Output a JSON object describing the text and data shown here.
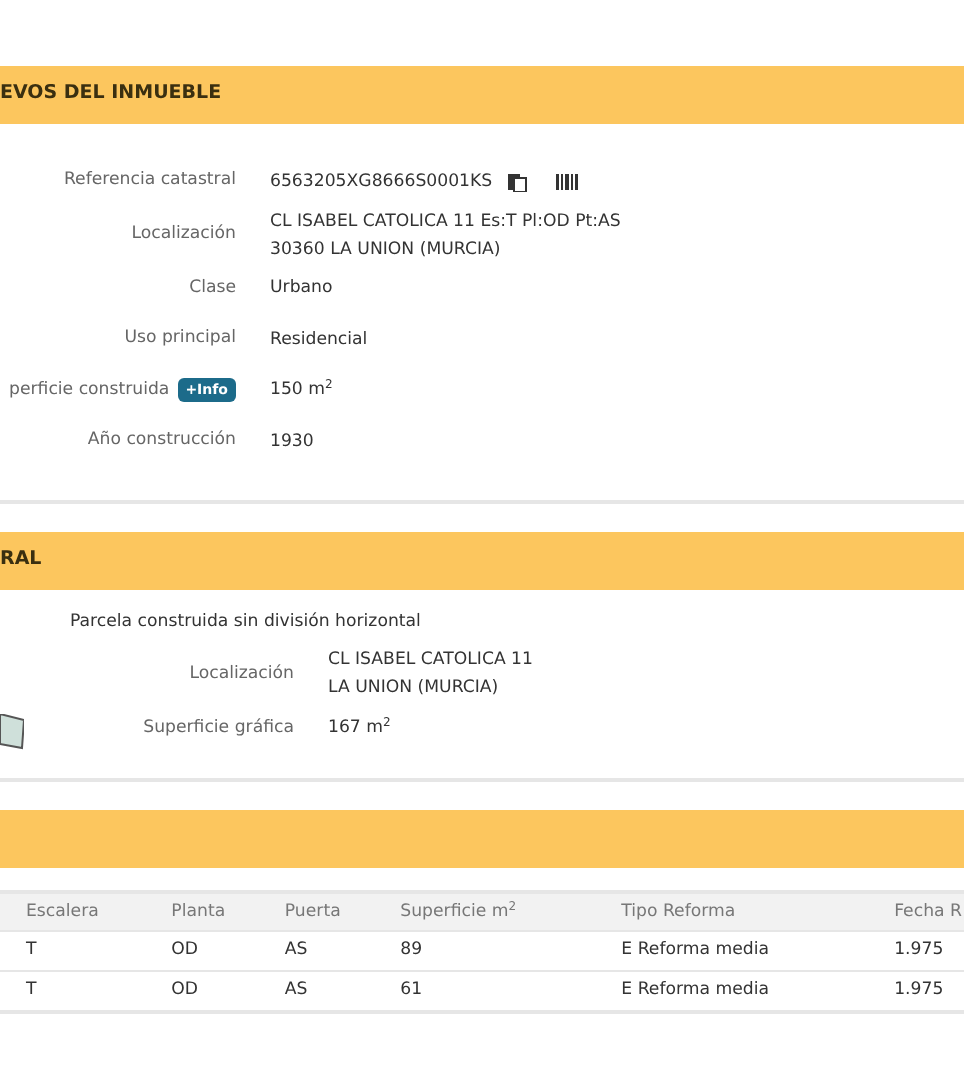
{
  "sections": [
    {
      "title": "EVOS DEL INMUEBLE",
      "kind": "fields",
      "fields": [
        {
          "label": "Referencia catastral",
          "value": "6563205XG8666S0001KS",
          "icons": true
        },
        {
          "label": "Localización",
          "value": "CL ISABEL CATOLICA 11 Es:T Pl:OD Pt:AS",
          "value2": "30360 LA UNION (MURCIA)"
        },
        {
          "label": "Clase",
          "value": "Urbano"
        },
        {
          "label": "Uso principal",
          "value": "Residencial"
        },
        {
          "label": "perficie construida",
          "badge": "+Info",
          "value": "150 m$^{2}$"
        },
        {
          "label": "Año construcción",
          "value": "1930"
        }
      ]
    },
    {
      "title": "RAL",
      "kind": "parcel",
      "caption": "Parcela construida sin división horizontal",
      "fields": [
        {
          "label": "Localización",
          "value": "CL ISABEL CATOLICA 11",
          "value2": "LA UNION (MURCIA)"
        },
        {
          "label": "Superficie gráfica",
          "value": "167 m$^{2}$"
        }
      ]
    },
    {
      "kind": "table",
      "columns": [
        "Escalera",
        "Planta",
        "Puerta",
        "Superficie m$^{2}$",
        "Tipo Reforma",
        "Fecha R"
      ],
      "rows": [
        [
          "T",
          "OD",
          "AS",
          "89",
          "E Reforma media",
          "1.975"
        ],
        [
          "T",
          "OD",
          "AS",
          "61",
          "E Reforma media",
          "1.975"
        ]
      ]
    }
  ]
}
